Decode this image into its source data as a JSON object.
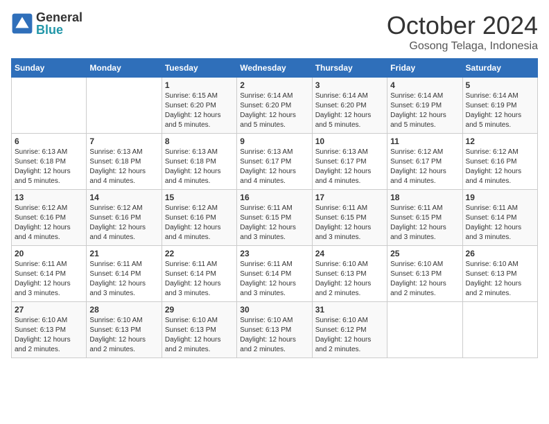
{
  "header": {
    "logo_line1": "General",
    "logo_line2": "Blue",
    "title": "October 2024",
    "subtitle": "Gosong Telaga, Indonesia"
  },
  "days_of_week": [
    "Sunday",
    "Monday",
    "Tuesday",
    "Wednesday",
    "Thursday",
    "Friday",
    "Saturday"
  ],
  "weeks": [
    [
      {
        "day": "",
        "info": ""
      },
      {
        "day": "",
        "info": ""
      },
      {
        "day": "1",
        "info": "Sunrise: 6:15 AM\nSunset: 6:20 PM\nDaylight: 12 hours and 5 minutes."
      },
      {
        "day": "2",
        "info": "Sunrise: 6:14 AM\nSunset: 6:20 PM\nDaylight: 12 hours and 5 minutes."
      },
      {
        "day": "3",
        "info": "Sunrise: 6:14 AM\nSunset: 6:20 PM\nDaylight: 12 hours and 5 minutes."
      },
      {
        "day": "4",
        "info": "Sunrise: 6:14 AM\nSunset: 6:19 PM\nDaylight: 12 hours and 5 minutes."
      },
      {
        "day": "5",
        "info": "Sunrise: 6:14 AM\nSunset: 6:19 PM\nDaylight: 12 hours and 5 minutes."
      }
    ],
    [
      {
        "day": "6",
        "info": "Sunrise: 6:13 AM\nSunset: 6:18 PM\nDaylight: 12 hours and 5 minutes."
      },
      {
        "day": "7",
        "info": "Sunrise: 6:13 AM\nSunset: 6:18 PM\nDaylight: 12 hours and 4 minutes."
      },
      {
        "day": "8",
        "info": "Sunrise: 6:13 AM\nSunset: 6:18 PM\nDaylight: 12 hours and 4 minutes."
      },
      {
        "day": "9",
        "info": "Sunrise: 6:13 AM\nSunset: 6:17 PM\nDaylight: 12 hours and 4 minutes."
      },
      {
        "day": "10",
        "info": "Sunrise: 6:13 AM\nSunset: 6:17 PM\nDaylight: 12 hours and 4 minutes."
      },
      {
        "day": "11",
        "info": "Sunrise: 6:12 AM\nSunset: 6:17 PM\nDaylight: 12 hours and 4 minutes."
      },
      {
        "day": "12",
        "info": "Sunrise: 6:12 AM\nSunset: 6:16 PM\nDaylight: 12 hours and 4 minutes."
      }
    ],
    [
      {
        "day": "13",
        "info": "Sunrise: 6:12 AM\nSunset: 6:16 PM\nDaylight: 12 hours and 4 minutes."
      },
      {
        "day": "14",
        "info": "Sunrise: 6:12 AM\nSunset: 6:16 PM\nDaylight: 12 hours and 4 minutes."
      },
      {
        "day": "15",
        "info": "Sunrise: 6:12 AM\nSunset: 6:16 PM\nDaylight: 12 hours and 4 minutes."
      },
      {
        "day": "16",
        "info": "Sunrise: 6:11 AM\nSunset: 6:15 PM\nDaylight: 12 hours and 3 minutes."
      },
      {
        "day": "17",
        "info": "Sunrise: 6:11 AM\nSunset: 6:15 PM\nDaylight: 12 hours and 3 minutes."
      },
      {
        "day": "18",
        "info": "Sunrise: 6:11 AM\nSunset: 6:15 PM\nDaylight: 12 hours and 3 minutes."
      },
      {
        "day": "19",
        "info": "Sunrise: 6:11 AM\nSunset: 6:14 PM\nDaylight: 12 hours and 3 minutes."
      }
    ],
    [
      {
        "day": "20",
        "info": "Sunrise: 6:11 AM\nSunset: 6:14 PM\nDaylight: 12 hours and 3 minutes."
      },
      {
        "day": "21",
        "info": "Sunrise: 6:11 AM\nSunset: 6:14 PM\nDaylight: 12 hours and 3 minutes."
      },
      {
        "day": "22",
        "info": "Sunrise: 6:11 AM\nSunset: 6:14 PM\nDaylight: 12 hours and 3 minutes."
      },
      {
        "day": "23",
        "info": "Sunrise: 6:11 AM\nSunset: 6:14 PM\nDaylight: 12 hours and 3 minutes."
      },
      {
        "day": "24",
        "info": "Sunrise: 6:10 AM\nSunset: 6:13 PM\nDaylight: 12 hours and 2 minutes."
      },
      {
        "day": "25",
        "info": "Sunrise: 6:10 AM\nSunset: 6:13 PM\nDaylight: 12 hours and 2 minutes."
      },
      {
        "day": "26",
        "info": "Sunrise: 6:10 AM\nSunset: 6:13 PM\nDaylight: 12 hours and 2 minutes."
      }
    ],
    [
      {
        "day": "27",
        "info": "Sunrise: 6:10 AM\nSunset: 6:13 PM\nDaylight: 12 hours and 2 minutes."
      },
      {
        "day": "28",
        "info": "Sunrise: 6:10 AM\nSunset: 6:13 PM\nDaylight: 12 hours and 2 minutes."
      },
      {
        "day": "29",
        "info": "Sunrise: 6:10 AM\nSunset: 6:13 PM\nDaylight: 12 hours and 2 minutes."
      },
      {
        "day": "30",
        "info": "Sunrise: 6:10 AM\nSunset: 6:13 PM\nDaylight: 12 hours and 2 minutes."
      },
      {
        "day": "31",
        "info": "Sunrise: 6:10 AM\nSunset: 6:12 PM\nDaylight: 12 hours and 2 minutes."
      },
      {
        "day": "",
        "info": ""
      },
      {
        "day": "",
        "info": ""
      }
    ]
  ]
}
